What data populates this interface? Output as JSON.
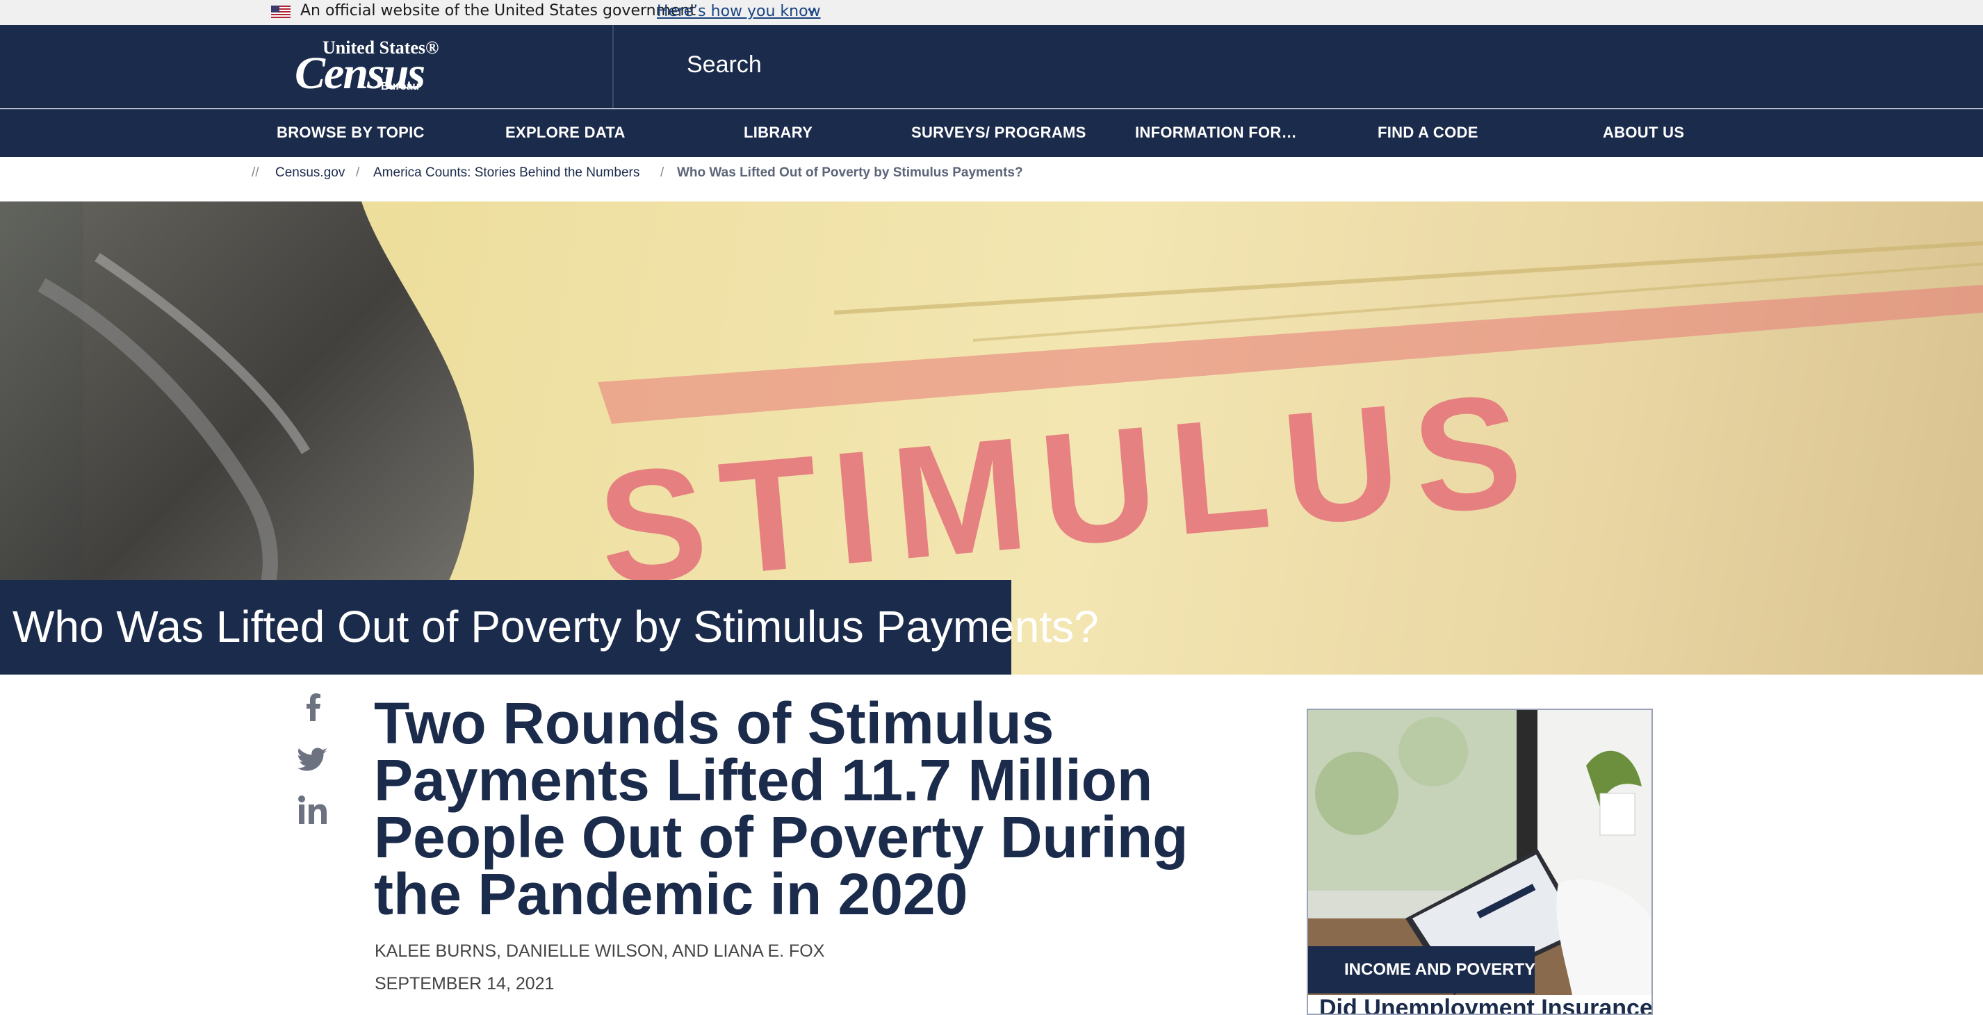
{
  "gov_banner": {
    "text": "An official website of the United States government",
    "link": "Here’s how you know"
  },
  "header": {
    "logo": {
      "line1": "United States®",
      "line2": "Census",
      "line3": "Bureau"
    },
    "search_label": "Search"
  },
  "nav": {
    "items": [
      "BROWSE BY TOPIC",
      "EXPLORE DATA",
      "LIBRARY",
      "SURVEYS/ PROGRAMS",
      "INFORMATION FOR…",
      "FIND A CODE",
      "ABOUT US"
    ]
  },
  "breadcrumb": {
    "prefix": "//",
    "items": [
      "Census.gov",
      "America Counts: Stories Behind the Numbers",
      "Who Was Lifted Out of Poverty by Stimulus Payments?"
    ],
    "separator": "/"
  },
  "hero": {
    "title": "Who Was Lifted Out of Poverty by Stimulus Payments?",
    "image_word": "STIMULUS"
  },
  "social": {
    "icons": [
      "facebook-icon",
      "twitter-icon",
      "linkedin-icon"
    ]
  },
  "article": {
    "title": "Two Rounds of Stimulus Payments Lifted 11.7 Million People Out of Poverty During the Pandemic in 2020",
    "authors": "KALEE BURNS, DANIELLE WILSON, AND LIANA E. FOX",
    "date": "SEPTEMBER 14, 2021"
  },
  "sidebar_card": {
    "tag": "INCOME AND POVERTY",
    "title": "Did Unemployment Insurance"
  },
  "colors": {
    "navy": "#1b2b4b",
    "banner_bg": "#f0f0f0",
    "link": "#1a4480"
  }
}
